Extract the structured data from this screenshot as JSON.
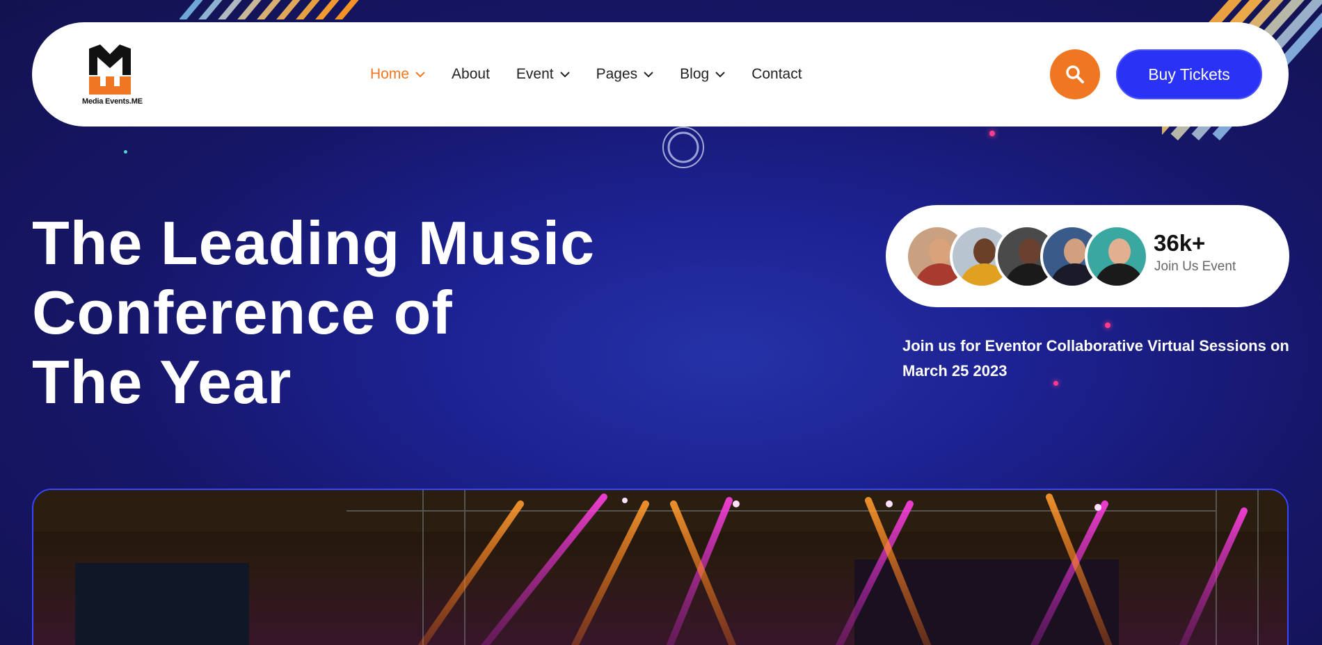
{
  "header": {
    "logo_text": "Media Events.ME",
    "nav": [
      {
        "label": "Home",
        "dropdown": true,
        "active": true
      },
      {
        "label": "About",
        "dropdown": false,
        "active": false
      },
      {
        "label": "Event",
        "dropdown": true,
        "active": false
      },
      {
        "label": "Pages",
        "dropdown": true,
        "active": false
      },
      {
        "label": "Blog",
        "dropdown": true,
        "active": false
      },
      {
        "label": "Contact",
        "dropdown": false,
        "active": false
      }
    ],
    "search_icon": "search-icon",
    "buy_tickets_label": "Buy Tickets"
  },
  "hero": {
    "title_lines": [
      "The Leading Music",
      "Conference of",
      "The Year"
    ],
    "join": {
      "count": "36k+",
      "label": "Join Us Event"
    },
    "sessions_text": "Join us for Eventor Collaborative Virtual Sessions on March 25 2023"
  },
  "colors": {
    "accent_orange": "#f07722",
    "button_blue": "#2a33f5",
    "background_navy": "#161668"
  }
}
